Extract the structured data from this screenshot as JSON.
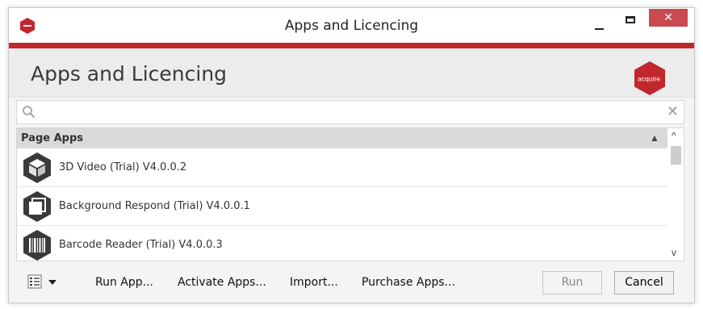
{
  "window": {
    "title": "Apps and Licencing",
    "close_glyph": "✕"
  },
  "header": {
    "title": "Apps and Licencing",
    "logo_text": "acquire"
  },
  "search": {
    "placeholder": "",
    "value": "",
    "clear_glyph": "✕"
  },
  "list": {
    "group_label": "Page Apps",
    "group_chevron": "▲",
    "items": [
      {
        "label": "3D Video (Trial) V4.0.0.2",
        "icon": "cube-icon"
      },
      {
        "label": "Background Respond (Trial) V4.0.0.1",
        "icon": "layers-icon"
      },
      {
        "label": "Barcode Reader (Trial) V4.0.0.3",
        "icon": "barcode-icon"
      }
    ],
    "scroll_up": "^",
    "scroll_down": "v"
  },
  "footer": {
    "links": [
      "Run App...",
      "Activate Apps...",
      "Import...",
      "Purchase Apps..."
    ],
    "run_label": "Run",
    "cancel_label": "Cancel"
  },
  "colors": {
    "accent": "#c0282d",
    "close_button": "#c94a4f",
    "icon_dark": "#3a3a3a"
  }
}
